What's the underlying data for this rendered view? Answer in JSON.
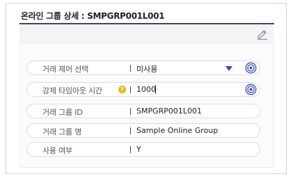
{
  "panel": {
    "title": "온라인 그룹 상세 : SMPGRP001L001"
  },
  "toolbar": {
    "edit_icon": "pencil-icon"
  },
  "fields": [
    {
      "label": "거래 제어 선택",
      "value": "미사용",
      "type": "select",
      "action_icon": "target-icon"
    },
    {
      "label": "강제 타임아웃 시간",
      "value": "1000",
      "type": "input",
      "help_icon": "question-icon",
      "action_icon": "target-icon"
    },
    {
      "label": "거래 그룹 ID",
      "value": "SMPGRP001L001",
      "type": "readonly"
    },
    {
      "label": "거래 그룹 명",
      "value": "Sample Online Group",
      "type": "readonly"
    },
    {
      "label": "사용 여부",
      "value": "Y",
      "type": "readonly"
    }
  ],
  "colors": {
    "accent": "#3c4cb0",
    "title_line": "#3c4480",
    "help": "#f0b323"
  }
}
